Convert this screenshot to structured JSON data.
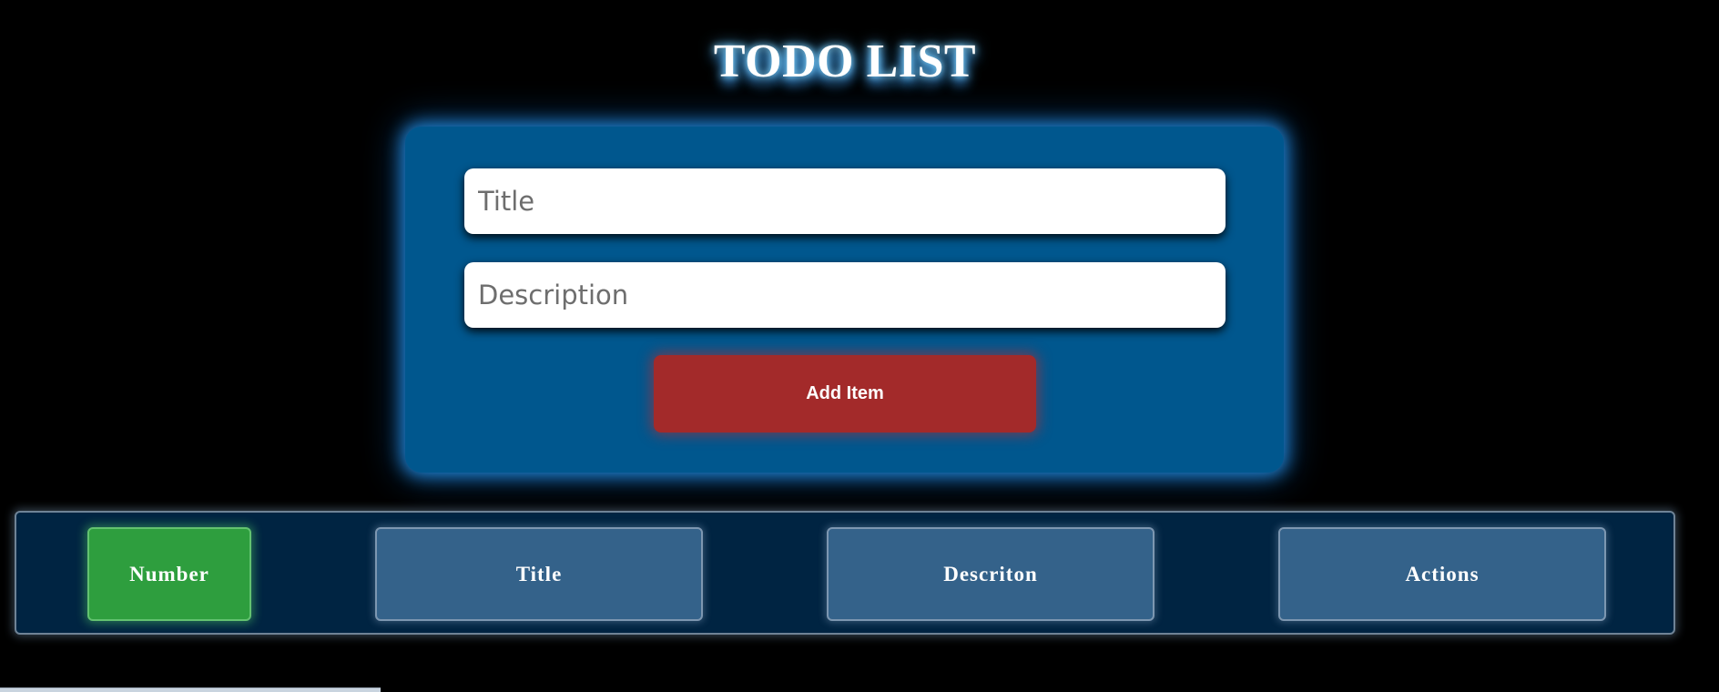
{
  "header": {
    "title": "TODO LIST"
  },
  "form": {
    "title_placeholder": "Title",
    "title_value": "",
    "description_placeholder": "Description",
    "description_value": "",
    "add_button_label": "Add Item"
  },
  "table": {
    "columns": [
      "Number",
      "Title",
      "Descriton",
      "Actions"
    ]
  },
  "colors": {
    "background": "#000000",
    "form_card": "#00578e",
    "add_button": "#a32a2a",
    "number_header": "#2e9e3e",
    "column_header": "#34628a",
    "table_bar": "#002442"
  }
}
